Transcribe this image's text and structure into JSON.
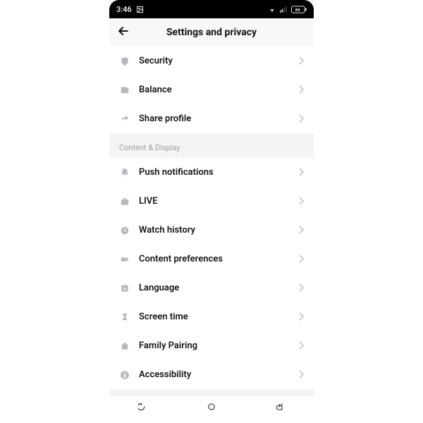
{
  "status": {
    "time": "3:46",
    "battery": "89"
  },
  "header": {
    "title": "Settings and privacy"
  },
  "groups": [
    {
      "items": [
        {
          "name": "security",
          "icon": "shield",
          "label": "Security"
        },
        {
          "name": "balance",
          "icon": "wallet",
          "label": "Balance"
        },
        {
          "name": "share-profile",
          "icon": "share",
          "label": "Share profile"
        }
      ]
    }
  ],
  "section_label": "Content & Display",
  "groups2": [
    {
      "items": [
        {
          "name": "push-notifications",
          "icon": "bell",
          "label": "Push notifications"
        },
        {
          "name": "live",
          "icon": "tv",
          "label": "LIVE"
        },
        {
          "name": "watch-history",
          "icon": "clock",
          "label": "Watch history"
        },
        {
          "name": "content-preferences",
          "icon": "video",
          "label": "Content preferences"
        },
        {
          "name": "language",
          "icon": "lang",
          "label": "Language"
        },
        {
          "name": "screen-time",
          "icon": "hourglass",
          "label": "Screen time"
        },
        {
          "name": "family-pairing",
          "icon": "home",
          "label": "Family Pairing"
        },
        {
          "name": "accessibility",
          "icon": "accessibility",
          "label": "Accessibility"
        }
      ]
    }
  ]
}
